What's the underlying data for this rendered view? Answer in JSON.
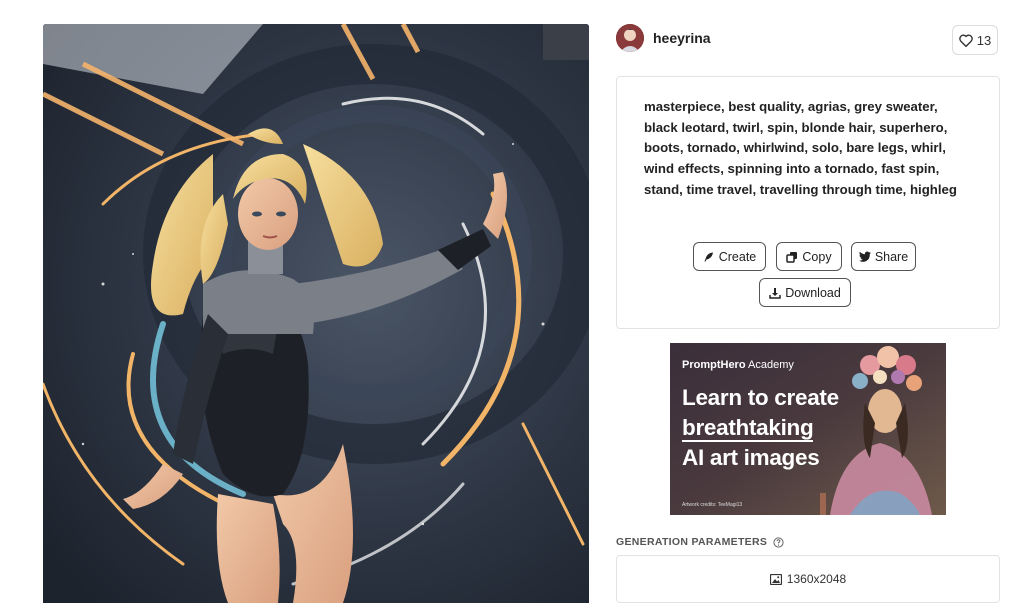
{
  "artwork": {
    "alt": "AI generated image: blonde superhero in grey sweater and black leotard spinning in a tornado"
  },
  "author": {
    "username": "heeyrina"
  },
  "likes": {
    "count": "13"
  },
  "prompt": {
    "text": "masterpiece, best quality, agrias, grey sweater, black leotard, twirl, spin, blonde hair, superhero, boots, tornado, whirlwind, solo, bare legs, whirl, wind effects, spinning into a tornado, fast spin, stand, time travel, travelling through time, highleg"
  },
  "actions": {
    "create": "Create",
    "copy": "Copy",
    "share": "Share",
    "download": "Download"
  },
  "ad": {
    "brand_bold": "PromptHero",
    "brand_rest": " Academy",
    "line1": "Learn to create",
    "line2": "breathtaking",
    "line3": "AI art images",
    "credit": "Artwork credits: TeeMagi13"
  },
  "generation": {
    "label": "GENERATION PARAMETERS",
    "resolution": "1360x2048"
  },
  "icons": [
    "heart-icon",
    "feather-icon",
    "copy-icon",
    "twitter-icon",
    "download-icon",
    "help-circle-icon",
    "image-icon"
  ]
}
